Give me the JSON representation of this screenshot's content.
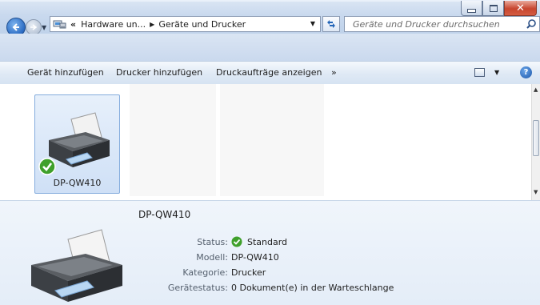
{
  "navigation": {
    "breadcrumbs": [
      "Hardware un...",
      "Geräte und Drucker"
    ],
    "overflow_chevron": "«",
    "search_placeholder": "Geräte und Drucker durchsuchen"
  },
  "toolbar": {
    "add_device": "Gerät hinzufügen",
    "add_printer": "Drucker hinzufügen",
    "show_print_jobs": "Druckaufträge anzeigen",
    "more": "»"
  },
  "devices": [
    {
      "name": "DP-QW410",
      "is_default": true
    }
  ],
  "details": {
    "title": "DP-QW410",
    "properties": [
      {
        "label": "Status:",
        "value": "Standard"
      },
      {
        "label": "Modell:",
        "value": "DP-QW410"
      },
      {
        "label": "Kategorie:",
        "value": "Drucker"
      },
      {
        "label": "Gerätestatus:",
        "value": "0 Dokument(e) in der Warteschlange"
      }
    ]
  },
  "colors": {
    "selection_border": "#84acdd",
    "status_ok": "#3fa02b"
  },
  "icons": [
    "back-icon",
    "forward-icon",
    "devices-folder-icon",
    "refresh-icon",
    "search-icon",
    "view-options-icon",
    "help-icon",
    "printer-icon",
    "default-checkmark-icon"
  ]
}
